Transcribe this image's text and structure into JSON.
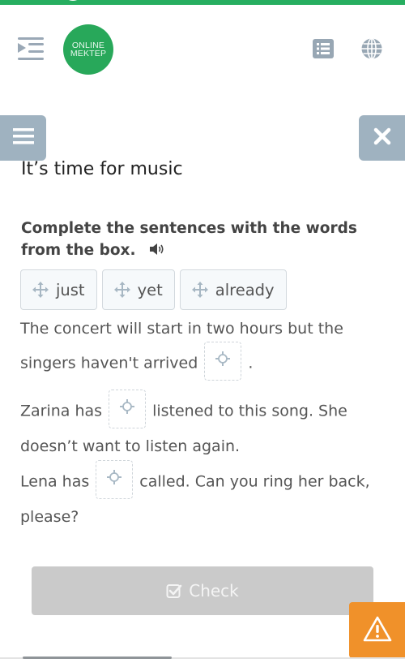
{
  "header": {
    "logo_line1": "ONLINE",
    "logo_line2": "MEKTEP",
    "brand_color": "#28a85a",
    "icons": [
      "menu-indent-icon",
      "list-icon",
      "globe-icon"
    ]
  },
  "side_buttons": {
    "left_icon": "hamburger-icon",
    "right_icon": "close-icon"
  },
  "exercise": {
    "title": "It’s time for music",
    "instruction": "Complete the sentences with the words from the box.",
    "word_bank": [
      {
        "label": "just"
      },
      {
        "label": "yet"
      },
      {
        "label": "already"
      }
    ],
    "sentences": [
      {
        "before": "The concert will start in two hours but the singers haven't arrived",
        "after": "."
      },
      {
        "before": "Zarina has",
        "after": "listened to this song. She doesn’t want to listen again."
      },
      {
        "before": "Lena has",
        "after": "called. Can you ring her back, please?"
      }
    ]
  },
  "footer": {
    "check_label": "Check",
    "warning_icon": "warning-icon",
    "warning_color": "#f0912a"
  }
}
